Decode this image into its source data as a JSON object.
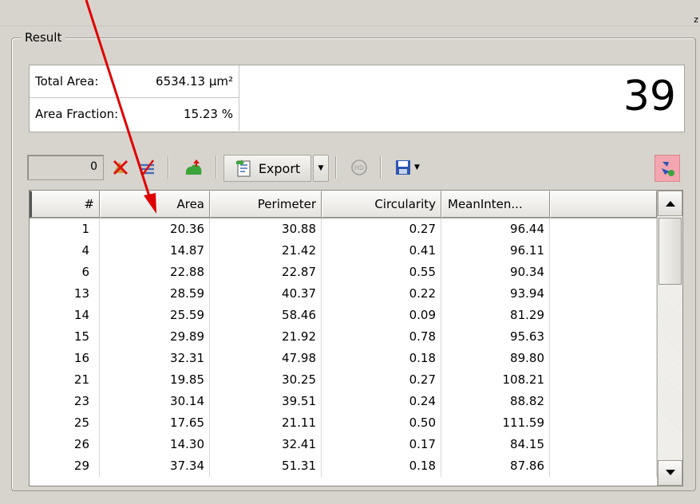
{
  "corner_mark": "z",
  "group": {
    "label": "Result"
  },
  "summary": {
    "total_area_label": "Total Area:",
    "total_area_value": "6534.13 µm²",
    "area_fraction_label": "Area Fraction:",
    "area_fraction_value": "15.23 %",
    "count": "39"
  },
  "toolbar": {
    "counter_value": "0",
    "export_label": "Export",
    "icons": [
      "delete-selected-icon",
      "delete-all-icon",
      "add-icon",
      "export-icon",
      "hd-icon",
      "save-icon",
      "refresh-icon"
    ]
  },
  "table": {
    "columns": [
      "#",
      "Area",
      "Perimeter",
      "Circularity",
      "MeanInten...",
      ""
    ],
    "rows": [
      [
        "1",
        "20.36",
        "30.88",
        "0.27",
        "96.44"
      ],
      [
        "4",
        "14.87",
        "21.42",
        "0.41",
        "96.11"
      ],
      [
        "6",
        "22.88",
        "22.87",
        "0.55",
        "90.34"
      ],
      [
        "13",
        "28.59",
        "40.37",
        "0.22",
        "93.94"
      ],
      [
        "14",
        "25.59",
        "58.46",
        "0.09",
        "81.29"
      ],
      [
        "15",
        "29.89",
        "21.92",
        "0.78",
        "95.63"
      ],
      [
        "16",
        "32.31",
        "47.98",
        "0.18",
        "89.80"
      ],
      [
        "21",
        "19.85",
        "30.25",
        "0.27",
        "108.21"
      ],
      [
        "23",
        "30.14",
        "39.51",
        "0.24",
        "88.82"
      ],
      [
        "25",
        "17.65",
        "21.11",
        "0.50",
        "111.59"
      ],
      [
        "26",
        "14.30",
        "32.41",
        "0.17",
        "84.15"
      ],
      [
        "29",
        "37.34",
        "51.31",
        "0.18",
        "87.86"
      ]
    ]
  },
  "colors": {
    "panel": "#d7d4cd",
    "annotation_arrow": "#e00000",
    "refresh_button": "#f3a6b0"
  }
}
